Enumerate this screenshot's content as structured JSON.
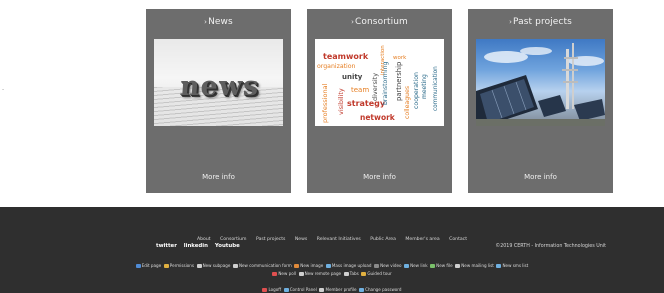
{
  "page": {
    "side_mark": "-"
  },
  "cards": [
    {
      "title": "News",
      "more": "More info",
      "image_word": "news"
    },
    {
      "title": "Consortium",
      "more": "More info"
    },
    {
      "title": "Past projects",
      "more": "More info"
    }
  ],
  "cloud_words": [
    {
      "text": "teamwork",
      "color": "#c0392b"
    },
    {
      "text": "organization",
      "color": "#e67e22"
    },
    {
      "text": "unity",
      "color": "#444444"
    },
    {
      "text": "team",
      "color": "#e67e22"
    },
    {
      "text": "strategy",
      "color": "#c0392b"
    },
    {
      "text": "network",
      "color": "#c0392b"
    },
    {
      "text": "professional",
      "color": "#e67e22"
    },
    {
      "text": "visibility",
      "color": "#c0392b"
    },
    {
      "text": "diversity",
      "color": "#444444"
    },
    {
      "text": "brainstorming",
      "color": "#2a6a8a"
    },
    {
      "text": "partnership",
      "color": "#444444"
    },
    {
      "text": "colleagues",
      "color": "#e67e22"
    },
    {
      "text": "cooperation",
      "color": "#2a6a8a"
    },
    {
      "text": "meeting",
      "color": "#2a6a8a"
    },
    {
      "text": "communication",
      "color": "#2a6a8a"
    },
    {
      "text": "interaction",
      "color": "#e67e22"
    },
    {
      "text": "work",
      "color": "#e67e22"
    }
  ],
  "footer": {
    "links": [
      "About",
      "Consortium",
      "Past projects",
      "News",
      "Relevant Initiatives",
      "Public Area",
      "Member's area",
      "Contact"
    ],
    "social": [
      "twitter",
      "linkedin",
      "Youtube"
    ],
    "copyright": "©2019 CERTH - Information Technologies Unit",
    "admin_row1": [
      {
        "label": "Edit page",
        "icon_color": "#4f8bd6"
      },
      {
        "label": "Permissions",
        "icon_color": "#e0b040"
      },
      {
        "label": "New subpage",
        "icon_color": "#cfcfcf"
      },
      {
        "label": "New communication form",
        "icon_color": "#cfcfcf"
      },
      {
        "label": "New image",
        "icon_color": "#e08a3a"
      },
      {
        "label": "Mass image upload",
        "icon_color": "#6fb0e0"
      },
      {
        "label": "New video",
        "icon_color": "#8a8a8a"
      },
      {
        "label": "New link",
        "icon_color": "#6fb0e0"
      },
      {
        "label": "New file",
        "icon_color": "#7ac06a"
      },
      {
        "label": "New mailing list",
        "icon_color": "#cfcfcf"
      },
      {
        "label": "New sms list",
        "icon_color": "#6fb0e0"
      }
    ],
    "admin_row2": [
      {
        "label": "New poll",
        "icon_color": "#e05050"
      },
      {
        "label": "New remote page",
        "icon_color": "#cfcfcf"
      },
      {
        "label": "Tabs",
        "icon_color": "#cfcfcf"
      },
      {
        "label": "Guided tour",
        "icon_color": "#e0b040"
      }
    ],
    "admin_row3": [
      {
        "label": "Logoff",
        "icon_color": "#e05050"
      },
      {
        "label": "Control Panel",
        "icon_color": "#6fb0e0"
      },
      {
        "label": "Member profile",
        "icon_color": "#cfcfcf"
      },
      {
        "label": "Change password",
        "icon_color": "#6fb0e0"
      }
    ]
  }
}
